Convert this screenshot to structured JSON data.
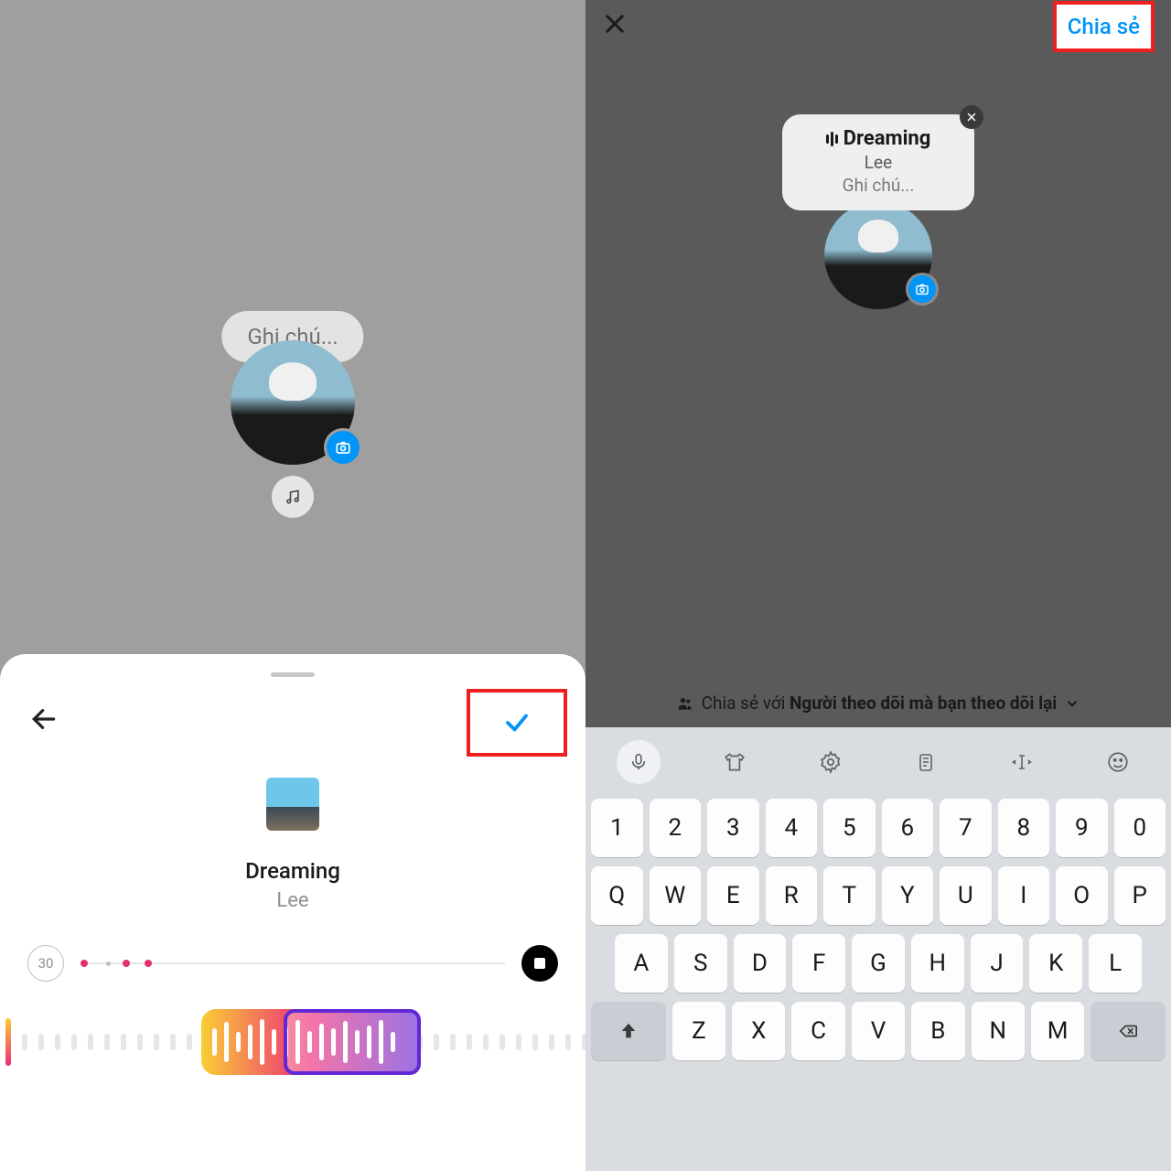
{
  "left": {
    "note_placeholder": "Ghi chú...",
    "sheet": {
      "song_title": "Dreaming",
      "song_artist": "Lee",
      "duration_seconds": "30"
    }
  },
  "right": {
    "share_button": "Chia sẻ",
    "note_card": {
      "song_title": "Dreaming",
      "song_artist": "Lee",
      "note_placeholder": "Ghi chú..."
    },
    "share_with_prefix": "Chia sẻ với ",
    "share_with_audience": "Người theo dõi mà bạn theo dõi lại"
  },
  "keyboard": {
    "row1": [
      "1",
      "2",
      "3",
      "4",
      "5",
      "6",
      "7",
      "8",
      "9",
      "0"
    ],
    "row2": [
      "Q",
      "W",
      "E",
      "R",
      "T",
      "Y",
      "U",
      "I",
      "O",
      "P"
    ],
    "row3": [
      "A",
      "S",
      "D",
      "F",
      "G",
      "H",
      "J",
      "K",
      "L"
    ],
    "row4": [
      "Z",
      "X",
      "C",
      "V",
      "B",
      "N",
      "M"
    ]
  }
}
